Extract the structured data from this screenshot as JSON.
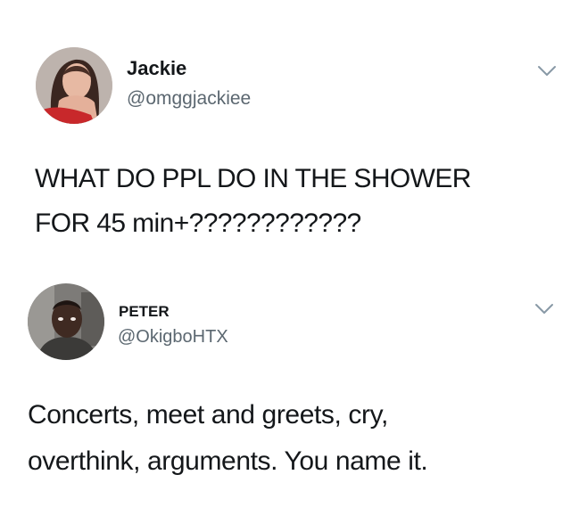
{
  "tweets": [
    {
      "display_name": "Jackie",
      "handle": "@omggjackiee",
      "text_lines": [
        "WHAT DO PPL DO IN THE SHOWER",
        "FOR 45 min+????????????"
      ],
      "avatar_icon": "profile-photo-icon",
      "menu_icon": "chevron-down-icon"
    },
    {
      "display_name": "PETER",
      "handle": "@OkigboHTX",
      "text_lines": [
        "Concerts, meet and greets, cry,",
        "overthink, arguments. You name it."
      ],
      "avatar_icon": "profile-photo-icon",
      "menu_icon": "chevron-down-icon"
    }
  ],
  "colors": {
    "background": "#ffffff",
    "text": "#14171a",
    "secondary_text": "#5b6770",
    "chevron": "#8899a6"
  }
}
